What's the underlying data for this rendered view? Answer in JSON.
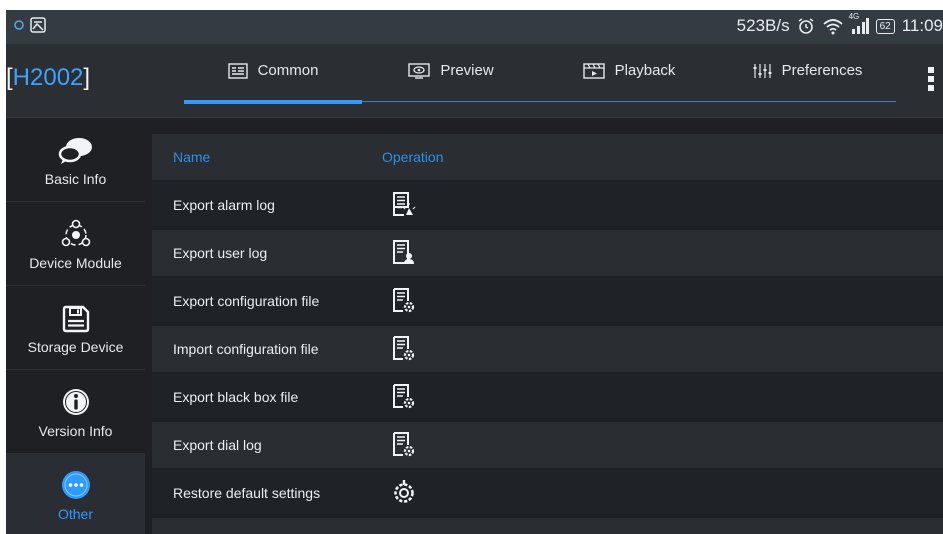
{
  "status_bar": {
    "speed": "523B/s",
    "network": "4G",
    "battery": "62",
    "time": "11:09"
  },
  "header": {
    "device_name": "H2002",
    "tabs": [
      {
        "label": "Common",
        "icon": "common-icon"
      },
      {
        "label": "Preview",
        "icon": "preview-icon"
      },
      {
        "label": "Playback",
        "icon": "playback-icon"
      },
      {
        "label": "Preferences",
        "icon": "preferences-icon"
      }
    ],
    "active_tab": "Common"
  },
  "sidebar": {
    "items": [
      {
        "label": "Basic Info",
        "icon": "chat-bubbles-icon"
      },
      {
        "label": "Device Module",
        "icon": "module-icon"
      },
      {
        "label": "Storage Device",
        "icon": "floppy-disk-icon"
      },
      {
        "label": "Version Info",
        "icon": "info-icon"
      },
      {
        "label": "Other",
        "icon": "more-icon"
      }
    ],
    "active_item": "Other"
  },
  "table": {
    "columns": [
      "Name",
      "Operation"
    ],
    "rows": [
      {
        "name": "Export alarm log",
        "icon": "alarm-log-icon"
      },
      {
        "name": "Export user log",
        "icon": "user-log-icon"
      },
      {
        "name": "Export configuration file",
        "icon": "config-file-icon"
      },
      {
        "name": "Import configuration file",
        "icon": "config-file-icon"
      },
      {
        "name": "Export black box file",
        "icon": "config-file-icon"
      },
      {
        "name": "Export dial log",
        "icon": "config-file-icon"
      },
      {
        "name": "Restore default settings",
        "icon": "restore-icon"
      }
    ]
  },
  "colors": {
    "accent": "#2f9bff",
    "background": "#1e2024",
    "header": "#2b2e33",
    "status_bar": "#343b41"
  }
}
